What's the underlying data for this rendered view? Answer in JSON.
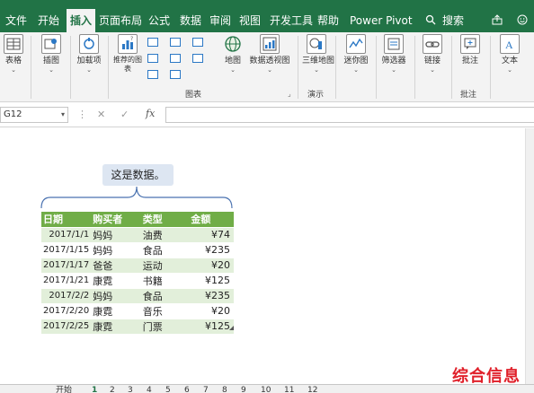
{
  "menu": {
    "items": [
      "文件",
      "开始",
      "插入",
      "页面布局",
      "公式",
      "数据",
      "审阅",
      "视图",
      "开发工具",
      "帮助",
      "Power Pivot",
      "搜索"
    ],
    "active": "插入"
  },
  "ribbon": {
    "buttons": {
      "table": "表格",
      "illustrations": "插图",
      "addins": "加载项",
      "recommended_charts": "推荐的图表",
      "map": "地图",
      "pivot_chart": "数据透视图",
      "map3d": "三维地图",
      "sparklines": "迷你图",
      "filters": "筛选器",
      "links": "链接",
      "comments": "批注",
      "text": "文本"
    },
    "groups": {
      "charts": "图表",
      "tours": "演示",
      "comments": "批注"
    }
  },
  "formula_bar": {
    "name_box": "G12",
    "fx": "fx",
    "value": ""
  },
  "callout": {
    "text": "这是数据。"
  },
  "table": {
    "headers": [
      "日期",
      "购买者",
      "类型",
      "金额"
    ],
    "rows": [
      {
        "date": "2017/1/1",
        "buyer": "妈妈",
        "type": "油费",
        "amount": "¥74"
      },
      {
        "date": "2017/1/15",
        "buyer": "妈妈",
        "type": "食品",
        "amount": "¥235"
      },
      {
        "date": "2017/1/17",
        "buyer": "爸爸",
        "type": "运动",
        "amount": "¥20"
      },
      {
        "date": "2017/1/21",
        "buyer": "康霓",
        "type": "书籍",
        "amount": "¥125"
      },
      {
        "date": "2017/2/2",
        "buyer": "妈妈",
        "type": "食品",
        "amount": "¥235"
      },
      {
        "date": "2017/2/20",
        "buyer": "康霓",
        "type": "音乐",
        "amount": "¥20"
      },
      {
        "date": "2017/2/25",
        "buyer": "康霓",
        "type": "门票",
        "amount": "¥125"
      }
    ]
  },
  "sheet_tabs": [
    "开始",
    "1",
    "2",
    "3",
    "4",
    "5",
    "6",
    "7",
    "8",
    "9",
    "10",
    "11",
    "12"
  ],
  "watermark": "综合信息",
  "colors": {
    "excel_green": "#217346",
    "table_header": "#70ad47",
    "table_band": "#e2efda",
    "callout_bg": "#dde6f2",
    "watermark": "#e0202a"
  }
}
